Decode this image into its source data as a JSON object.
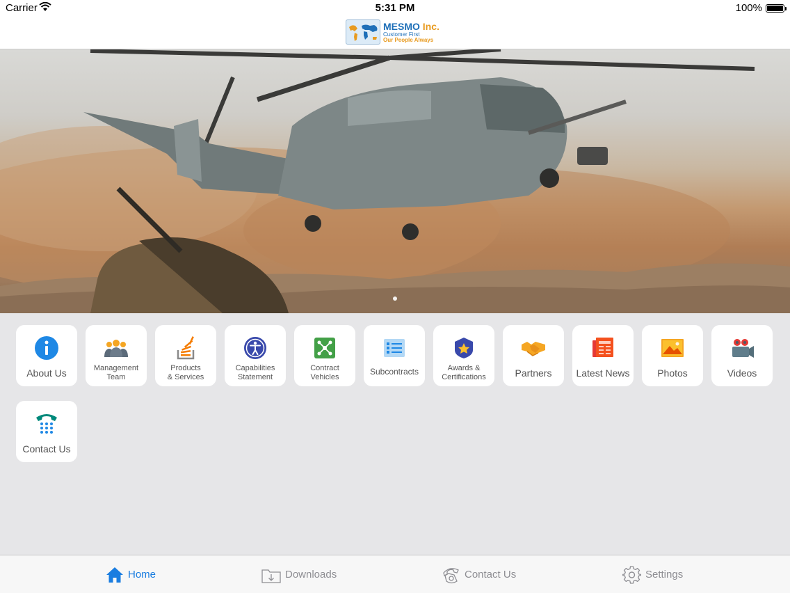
{
  "status_bar": {
    "carrier": "Carrier",
    "time": "5:31 PM",
    "battery": "100%"
  },
  "header": {
    "logo_name_1": "MESMO",
    "logo_name_2": "Inc.",
    "logo_tagline_1": "Customer First",
    "logo_tagline_2": "Our People Always"
  },
  "tiles": [
    {
      "label": "About Us",
      "icon": "info-icon"
    },
    {
      "label_1": "Management",
      "label_2": "Team",
      "icon": "people-icon"
    },
    {
      "label_1": "Products",
      "label_2": "& Services",
      "icon": "stack-icon"
    },
    {
      "label_1": "Capabilities",
      "label_2": "Statement",
      "icon": "accessibility-icon"
    },
    {
      "label_1": "Contract",
      "label_2": "Vehicles",
      "icon": "network-icon"
    },
    {
      "label": "Subcontracts",
      "icon": "list-icon"
    },
    {
      "label_1": "Awards &",
      "label_2": "Certifications",
      "icon": "badge-icon"
    },
    {
      "label": "Partners",
      "icon": "handshake-icon"
    },
    {
      "label": "Latest News",
      "icon": "newspaper-icon"
    },
    {
      "label": "Photos",
      "icon": "photo-icon"
    },
    {
      "label": "Videos",
      "icon": "video-camera-icon"
    },
    {
      "label": "Contact Us",
      "icon": "phone-icon"
    }
  ],
  "tab_bar": {
    "tabs": [
      {
        "label": "Home",
        "icon": "home-icon",
        "active": true
      },
      {
        "label": "Downloads",
        "icon": "download-icon"
      },
      {
        "label": "Contact Us",
        "icon": "phone-icon"
      },
      {
        "label": "Settings",
        "icon": "gear-icon"
      }
    ]
  },
  "colors": {
    "accent": "#1a7de0",
    "brand_blue": "#1e6fb8",
    "brand_orange": "#e89b20"
  }
}
